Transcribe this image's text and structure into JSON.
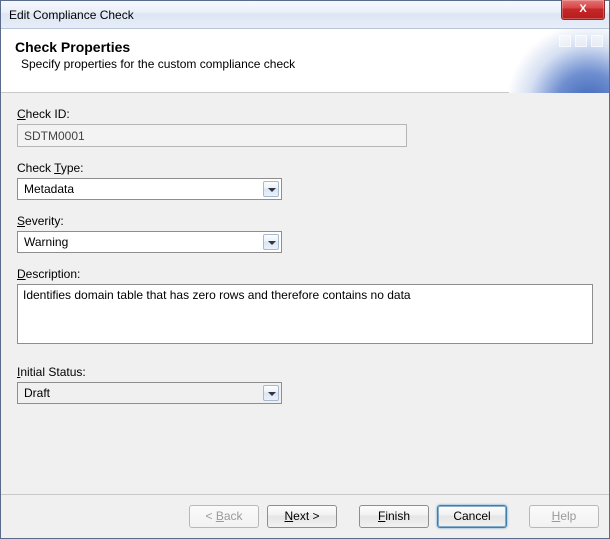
{
  "window": {
    "title": "Edit Compliance Check"
  },
  "header": {
    "title": "Check Properties",
    "subtitle": "Specify properties for the custom compliance check"
  },
  "fields": {
    "check_id": {
      "label_pre": "",
      "label_u": "C",
      "label_post": "heck ID:",
      "value": "SDTM0001"
    },
    "check_type": {
      "label_pre": "Check ",
      "label_u": "T",
      "label_post": "ype:",
      "value": "Metadata"
    },
    "severity": {
      "label_pre": "",
      "label_u": "S",
      "label_post": "everity:",
      "value": "Warning"
    },
    "description": {
      "label_pre": "",
      "label_u": "D",
      "label_post": "escription:",
      "value": "Identifies domain table that has zero rows and therefore contains no data"
    },
    "initial_status": {
      "label_pre": "",
      "label_u": "I",
      "label_post": "nitial Status:",
      "value": "Draft"
    }
  },
  "buttons": {
    "back": {
      "pre": "< ",
      "u": "B",
      "post": "ack"
    },
    "next": {
      "pre": "",
      "u": "N",
      "post": "ext >"
    },
    "finish": {
      "pre": "",
      "u": "F",
      "post": "inish"
    },
    "cancel": {
      "pre": "Cancel",
      "u": "",
      "post": ""
    },
    "help": {
      "pre": "",
      "u": "H",
      "post": "elp"
    }
  }
}
